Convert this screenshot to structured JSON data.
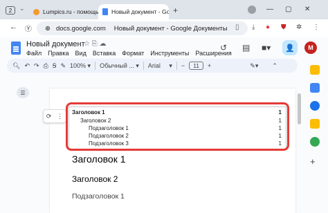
{
  "tabbar": {
    "tab_count": "2",
    "tabs": [
      {
        "title": "Lumpics.ru - помощь с ко"
      },
      {
        "title": "Новый документ - Goo"
      }
    ]
  },
  "address": {
    "domain": "docs.google.com",
    "page_title": "Новый документ - Google Документы"
  },
  "doc": {
    "title": "Новый документ",
    "menus": [
      "Файл",
      "Правка",
      "Вид",
      "Вставка",
      "Формат",
      "Инструменты",
      "Расширения"
    ],
    "avatar_letter": "M"
  },
  "toolbar": {
    "zoom": "100%",
    "style": "Обычный ...",
    "font": "Arial",
    "font_size": "11"
  },
  "toc": {
    "entries": [
      {
        "text": "Заголовок 1",
        "page": "1"
      },
      {
        "text": "Заголовок 2",
        "page": "1"
      },
      {
        "text": "Подзаголовок 1",
        "page": "1"
      },
      {
        "text": "Подзаголовок 2",
        "page": "1"
      },
      {
        "text": "Подзаголовок 3",
        "page": "1"
      }
    ]
  },
  "body": {
    "heading1": "Заголовок 1",
    "heading2": "Заголовок 2",
    "subheading": "Подзаголовок 1"
  },
  "colors": {
    "highlight": "#e53935",
    "docs_blue": "#4285f4",
    "avatar": "#c5221f"
  }
}
